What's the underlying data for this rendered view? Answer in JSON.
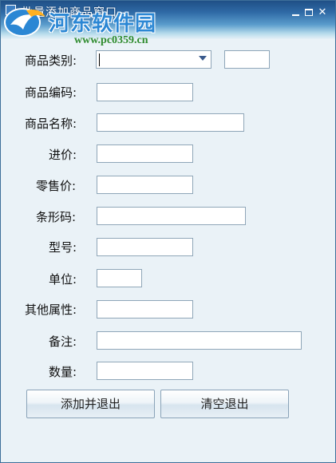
{
  "window": {
    "title": "批量添加商品窗口",
    "controls": {
      "minimize_icon": "minimize-icon",
      "maximize_icon": "maximize-icon",
      "close_icon": "close-icon",
      "close_glyph": "✕"
    }
  },
  "watermark": {
    "name": "河东软件园",
    "url": "www.pc0359.cn",
    "logo_icon": "logo-icon"
  },
  "form": {
    "category": {
      "label": "商品类别:",
      "value": "",
      "extra_value": ""
    },
    "code": {
      "label": "商品编码:",
      "value": ""
    },
    "name": {
      "label": "商品名称:",
      "value": ""
    },
    "purchase_price": {
      "label": "进价:",
      "value": ""
    },
    "retail_price": {
      "label": "零售价:",
      "value": ""
    },
    "barcode": {
      "label": "条形码:",
      "value": ""
    },
    "model": {
      "label": "型号:",
      "value": ""
    },
    "unit": {
      "label": "单位:",
      "value": ""
    },
    "other_attrs": {
      "label": "其他属性:",
      "value": ""
    },
    "remark": {
      "label": "备注:",
      "value": ""
    },
    "quantity": {
      "label": "数量:",
      "value": ""
    }
  },
  "buttons": {
    "add_and_exit": "添加并退出",
    "clear_and_exit": "清空退出"
  },
  "colors": {
    "title_bar_top": "#1f4f86",
    "title_bar_bottom": "#e6f1f7",
    "window_background": "#eaf2f7",
    "input_border": "#8fa6b8",
    "watermark_blue": "#2b87d4",
    "watermark_green": "#2e8b2e"
  }
}
